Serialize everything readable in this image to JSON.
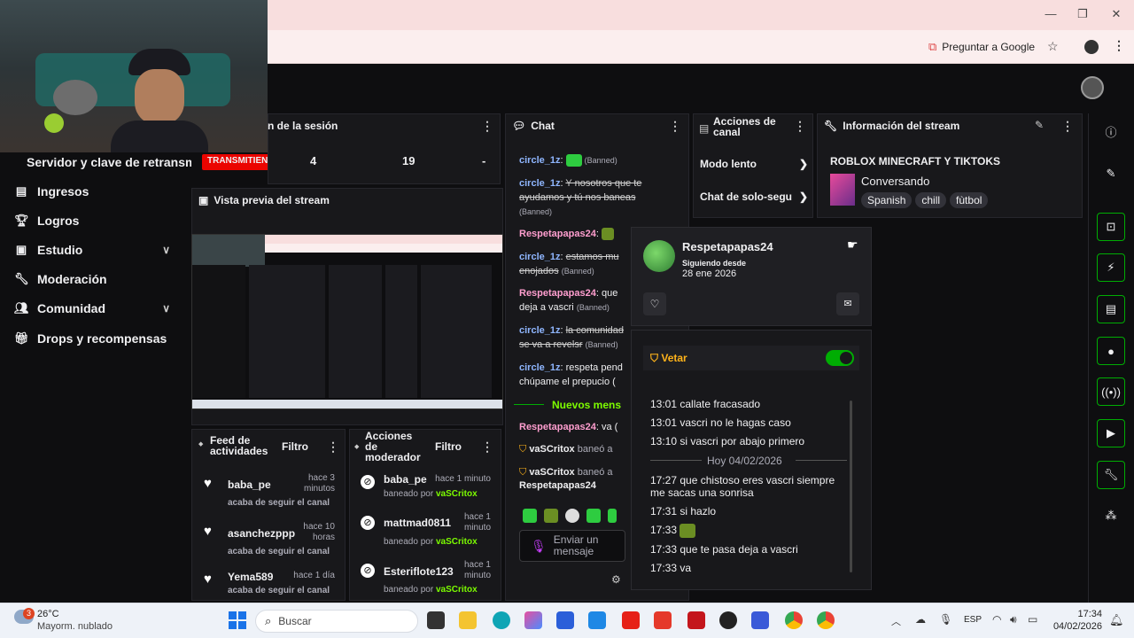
{
  "browser": {
    "ask_google": "Preguntar a Google",
    "window_controls": {
      "minimize": "—",
      "restore": "❐",
      "close": "✕"
    }
  },
  "stream": {
    "header_title": "Servidor y clave de retransm",
    "live_badge": "TRANSMITIENDO",
    "session_panel_title": "n de la sesión",
    "stats": [
      "4",
      "19",
      "-"
    ]
  },
  "sidebar": {
    "items": [
      {
        "label": "Ingresos",
        "icon": "money-icon"
      },
      {
        "label": "Logros",
        "icon": "trophy-icon"
      },
      {
        "label": "Estudio",
        "icon": "studio-icon",
        "expandable": true
      },
      {
        "label": "Moderación",
        "icon": "wrench-icon"
      },
      {
        "label": "Comunidad",
        "icon": "people-icon",
        "expandable": true
      },
      {
        "label": "Drops y recompensas",
        "icon": "gift-icon"
      }
    ]
  },
  "preview": {
    "title": "Vista previa del stream"
  },
  "activity_feed": {
    "title": "Feed de actividades",
    "filter": "Filtro",
    "items": [
      {
        "user": "baba_pe",
        "time": "hace 3 minutos",
        "action": "acaba de seguir el canal"
      },
      {
        "user": "asanchezppp",
        "time": "hace 10 horas",
        "action": "acaba de seguir el canal"
      },
      {
        "user": "Yema589",
        "time": "hace 1 día",
        "action": "acaba de seguir el canal"
      }
    ]
  },
  "mod_actions": {
    "title": "Acciones de moderador",
    "filter": "Filtro",
    "banned_by_label": "baneado por",
    "items": [
      {
        "user": "baba_pe",
        "time": "hace 1 minuto",
        "mod": "vaSCritox"
      },
      {
        "user": "mattmad0811",
        "time": "hace 1 minuto",
        "mod": "vaSCritox"
      },
      {
        "user": "Esteriflote123",
        "time": "hace 1 minuto",
        "mod": "vaSCritox"
      }
    ]
  },
  "chat": {
    "title": "Chat",
    "banned_tag": "(Banned)",
    "messages": [
      {
        "user": "circle_1z",
        "text": "",
        "banned": true
      },
      {
        "user": "circle_1z",
        "text": "Y nosotros que te ayudamos y tú nos baneas",
        "banned": true
      },
      {
        "user": "Respetapapas24",
        "text": ""
      },
      {
        "user": "circle_1z",
        "text": "estamos mu enojados",
        "banned": true
      },
      {
        "user": "Respetapapas24",
        "text": "que deja a vascri",
        "banned": true
      },
      {
        "user": "circle_1z",
        "text": "la comunidad se va a revelsr",
        "banned": true
      },
      {
        "user": "circle_1z",
        "text": "respeta pend chúpame el prepucio (",
        "banned": false
      }
    ],
    "new_messages": "Nuevos mens",
    "after_new": {
      "user": "Respetapapas24",
      "text": "va ("
    },
    "mod_notices": [
      {
        "mod": "vaSCritox",
        "text": "baneó a"
      },
      {
        "mod": "vaSCritox",
        "text": "baneó a",
        "target": "Respetapapas24"
      }
    ],
    "input_placeholder": "Enviar un mensaje"
  },
  "channel_actions": {
    "title": "Acciones de canal",
    "items": [
      "Modo lento",
      "Chat de solo-segu"
    ]
  },
  "stream_info": {
    "title": "Información del stream",
    "stream_title": "ROBLOX MINECRAFT Y TIKTOKS",
    "category": "Conversando",
    "tags": [
      "Spanish",
      "chill",
      "fùtbol"
    ]
  },
  "user_card": {
    "username": "Respetapapas24",
    "following_label": "Siguiendo desde",
    "following_date": "28 ene 2026",
    "veto_label": "Vetar",
    "veto_on": true,
    "messages_before": [
      {
        "time": "13:01",
        "text": "callate fracasado"
      },
      {
        "time": "13:01",
        "text": "vascri no le hagas caso"
      },
      {
        "time": "13:10",
        "text": "si vascri por abajo primero"
      }
    ],
    "day_separator": "Hoy 04/02/2026",
    "messages_after": [
      {
        "time": "17:27",
        "text": "que chistoso eres vascri siempre me sacas una sonrisa"
      },
      {
        "time": "17:31",
        "text": "si hazlo"
      },
      {
        "time": "17:33",
        "text": ""
      },
      {
        "time": "17:33",
        "text": "que te pasa deja a vascri"
      },
      {
        "time": "17:33",
        "text": "va"
      }
    ]
  },
  "taskbar": {
    "weather_temp": "26°C",
    "weather_desc": "Mayorm. nublado",
    "weather_badge": "3",
    "search": "Buscar",
    "lang": "ESP",
    "time": "17:34",
    "date": "04/02/2026"
  },
  "colors": {
    "accent": "#00ad03",
    "live": "#eb0400",
    "veto": "#ffb31a",
    "panel": "#18181b"
  }
}
